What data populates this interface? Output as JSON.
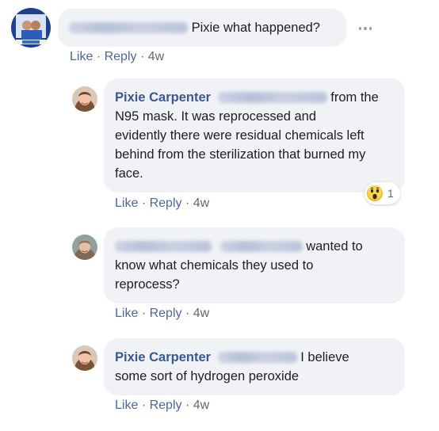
{
  "comments": [
    {
      "author": "",
      "text": "Pixie what happened?",
      "actions": {
        "like": "Like",
        "reply": "Reply",
        "time": "4w"
      }
    }
  ],
  "replies": [
    {
      "author": "Pixie Carpenter",
      "text": "from the N95 mask. It was reprocessed and evidently there were residual chemicals left behind from the sterilization that burned my face.",
      "line1": "from the",
      "line2": "N95 mask. It was reprocessed and",
      "line3": "evidently there were residual chemicals left",
      "line4": "behind from the sterilization that burned my",
      "line5": "face.",
      "reaction": {
        "icon": "wow-emoji-icon",
        "count": "1"
      },
      "actions": {
        "like": "Like",
        "reply": "Reply",
        "time": "4w"
      }
    },
    {
      "author": "",
      "line1": "wanted to",
      "line2": "know what chemicals they used to",
      "line3": "reprocess?",
      "actions": {
        "like": "Like",
        "reply": "Reply",
        "time": "4w"
      }
    },
    {
      "author": "Pixie Carpenter",
      "line1": "I believe",
      "line2": "some sort of hydrogen peroxide",
      "actions": {
        "like": "Like",
        "reply": "Reply",
        "time": "4w"
      }
    }
  ],
  "separator": "·",
  "colors": {
    "bubble": "#f0f2f5",
    "author": "#385898",
    "link": "#4b67a1",
    "meta": "#65676b"
  }
}
